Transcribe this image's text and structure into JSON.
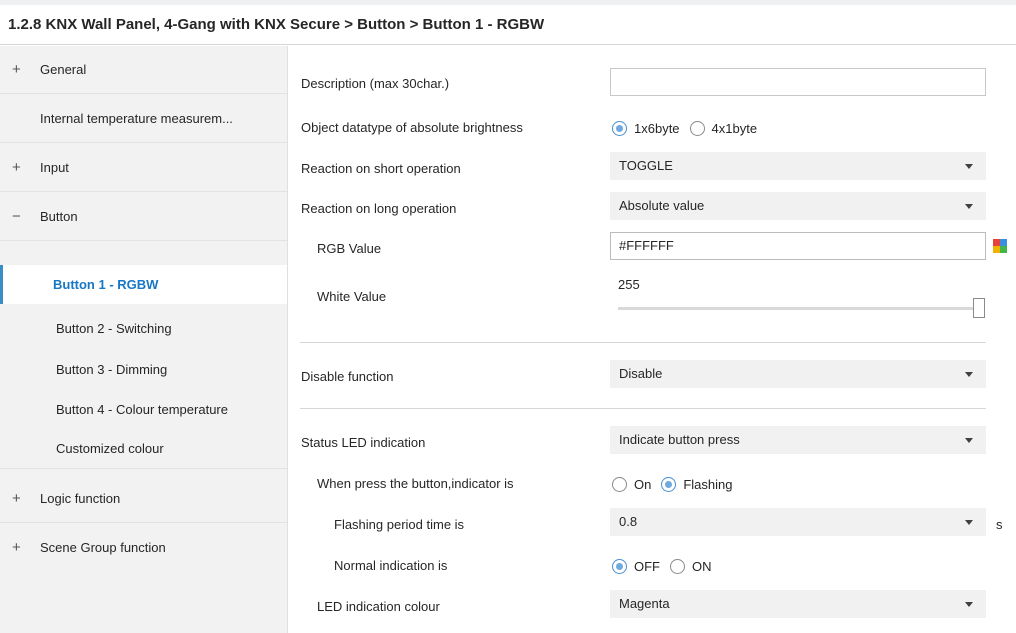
{
  "title": "1.2.8 KNX Wall Panel, 4-Gang with KNX Secure > Button > Button 1 - RGBW",
  "sidebar": {
    "items": [
      {
        "sign": "+",
        "label": "General"
      },
      {
        "sign": "",
        "label": "Internal temperature measurem..."
      },
      {
        "sign": "+",
        "label": "Input"
      },
      {
        "sign": "−",
        "label": "Button"
      },
      {
        "sign": "",
        "label": "Button 1 - RGBW"
      },
      {
        "sign": "",
        "label": "Button 2 - Switching"
      },
      {
        "sign": "",
        "label": "Button 3 - Dimming"
      },
      {
        "sign": "",
        "label": "Button 4 - Colour temperature"
      },
      {
        "sign": "",
        "label": "Customized colour"
      },
      {
        "sign": "+",
        "label": "Logic function"
      },
      {
        "sign": "+",
        "label": "Scene Group function"
      }
    ]
  },
  "params": {
    "description": {
      "label": "Description (max 30char.)",
      "value": ""
    },
    "datatype": {
      "label": "Object datatype of absolute brightness",
      "options": [
        "1x6byte",
        "4x1byte"
      ],
      "selected": "1x6byte"
    },
    "short_op": {
      "label": "Reaction on short operation",
      "value": "TOGGLE"
    },
    "long_op": {
      "label": "Reaction on long operation",
      "value": "Absolute value"
    },
    "rgb": {
      "label": "RGB Value",
      "value": "#FFFFFF"
    },
    "white": {
      "label": "White Value",
      "value": "255",
      "max": 255
    },
    "disable": {
      "label": "Disable function",
      "value": "Disable"
    },
    "status_led": {
      "label": "Status LED indication",
      "value": "Indicate button press"
    },
    "indicator": {
      "label": "When press the button,indicator is",
      "options": [
        "On",
        "Flashing"
      ],
      "selected": "Flashing"
    },
    "flash_period": {
      "label": "Flashing period time is",
      "value": "0.8",
      "unit": "s"
    },
    "normal": {
      "label": "Normal indication is",
      "options": [
        "OFF",
        "ON"
      ],
      "selected": "OFF"
    },
    "led_colour": {
      "label": "LED indication colour",
      "value": "Magenta"
    }
  },
  "colors": {
    "accent": "#1777c6",
    "palette": [
      "#e8413c",
      "#3b8ee0",
      "#f0b400",
      "#44b649"
    ]
  },
  "icons": {
    "palette": "colour-palette-icon",
    "dropdown": "chevron-down-icon"
  }
}
